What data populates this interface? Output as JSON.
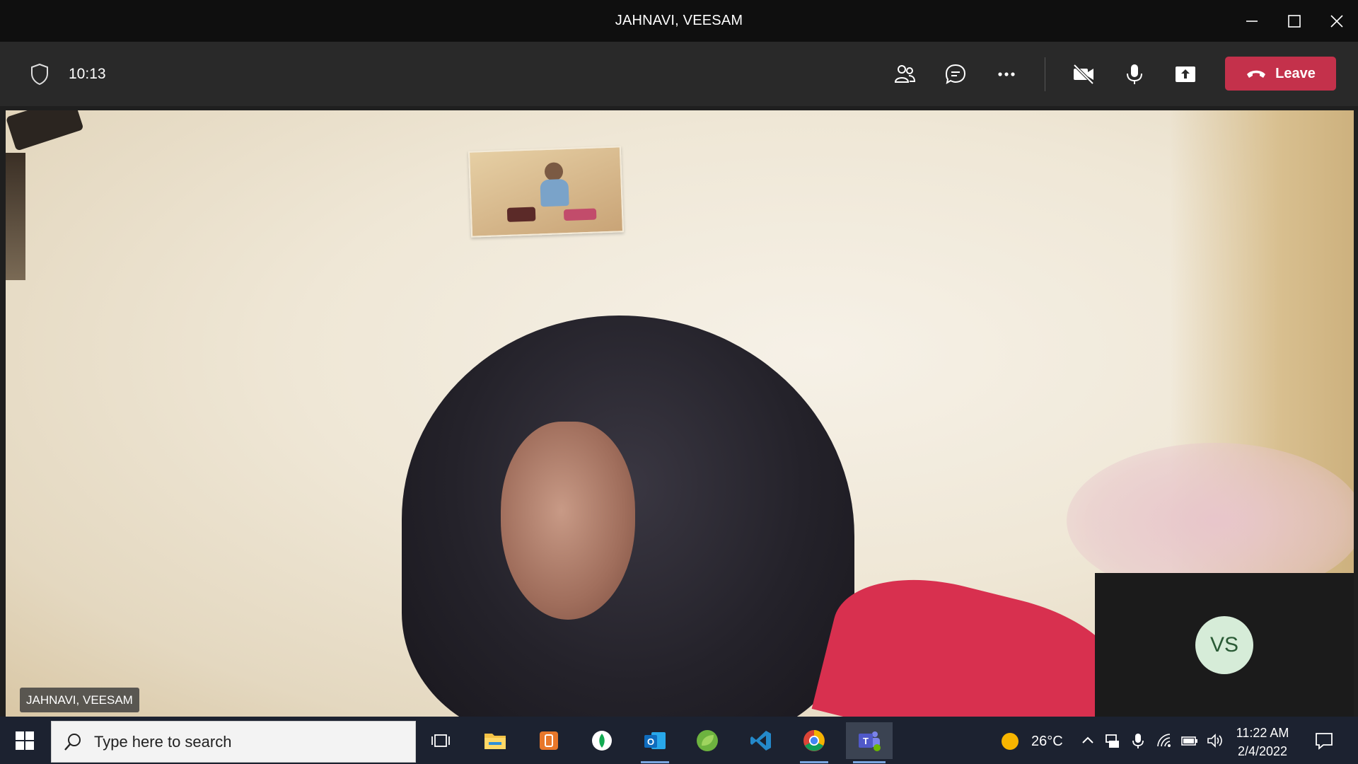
{
  "window": {
    "title": "JAHNAVI, VEESAM"
  },
  "toolbar": {
    "timer": "10:13",
    "leave_label": "Leave"
  },
  "stage": {
    "participant_name": "JAHNAVI, VEESAM",
    "self_initials": "VS"
  },
  "taskbar": {
    "search_placeholder": "Type here to search",
    "weather_temp": "26°C",
    "time": "11:22 AM",
    "date": "2/4/2022"
  },
  "colors": {
    "leave": "#c4314b",
    "titlebar": "#0f0f0f",
    "toolbar": "#292929",
    "taskbar": "#1c2230"
  }
}
